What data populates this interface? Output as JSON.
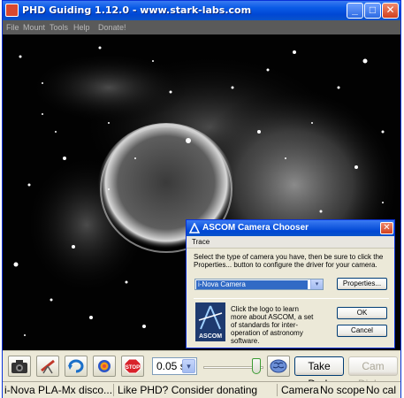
{
  "window": {
    "title": "PHD Guiding 1.12.0  -  www.stark-labs.com",
    "minimize_glyph": "_",
    "maximize_glyph": "□",
    "close_glyph": "✕"
  },
  "menu": [
    "File",
    "Mount",
    "Tools",
    "Help",
    "Donate!"
  ],
  "toolbar": {
    "exposure_value": "0.05 s",
    "dropdown_glyph": "▾",
    "take_dark_label": "Take Dark",
    "cam_dialog_label": "Cam Dialog",
    "stop_label": "STOP",
    "icons": [
      "camera-icon",
      "telescope-icon",
      "loop-icon",
      "guide-target-icon",
      "stop-icon",
      "brain-icon"
    ]
  },
  "statusbar": {
    "left": "i-Nova PLA-Mx disco...",
    "middle": "Like PHD? Consider donating",
    "camera": "Camera",
    "scope": "No scope",
    "cal": "No cal"
  },
  "dialog": {
    "title": "ASCOM Camera Chooser",
    "close_glyph": "✕",
    "menu": "Trace",
    "instruction": "Select the type of camera you have, then be sure to click the Properties... button to configure the driver for your camera.",
    "selected_camera": "i-Nova Camera",
    "dropdown_glyph": "▾",
    "properties_label": "Properties...",
    "logo_text": "Click the logo to learn more about ASCOM, a set of standards for inter-operation of astronomy software.",
    "logo_word": "ASCOM",
    "ok_label": "OK",
    "cancel_label": "Cancel"
  },
  "colors": {
    "titlebar": "#0a5be6",
    "menubar": "#5a5a5a",
    "image_background": "#000000",
    "face": "#ece9d8",
    "stop": "#d8222a"
  }
}
